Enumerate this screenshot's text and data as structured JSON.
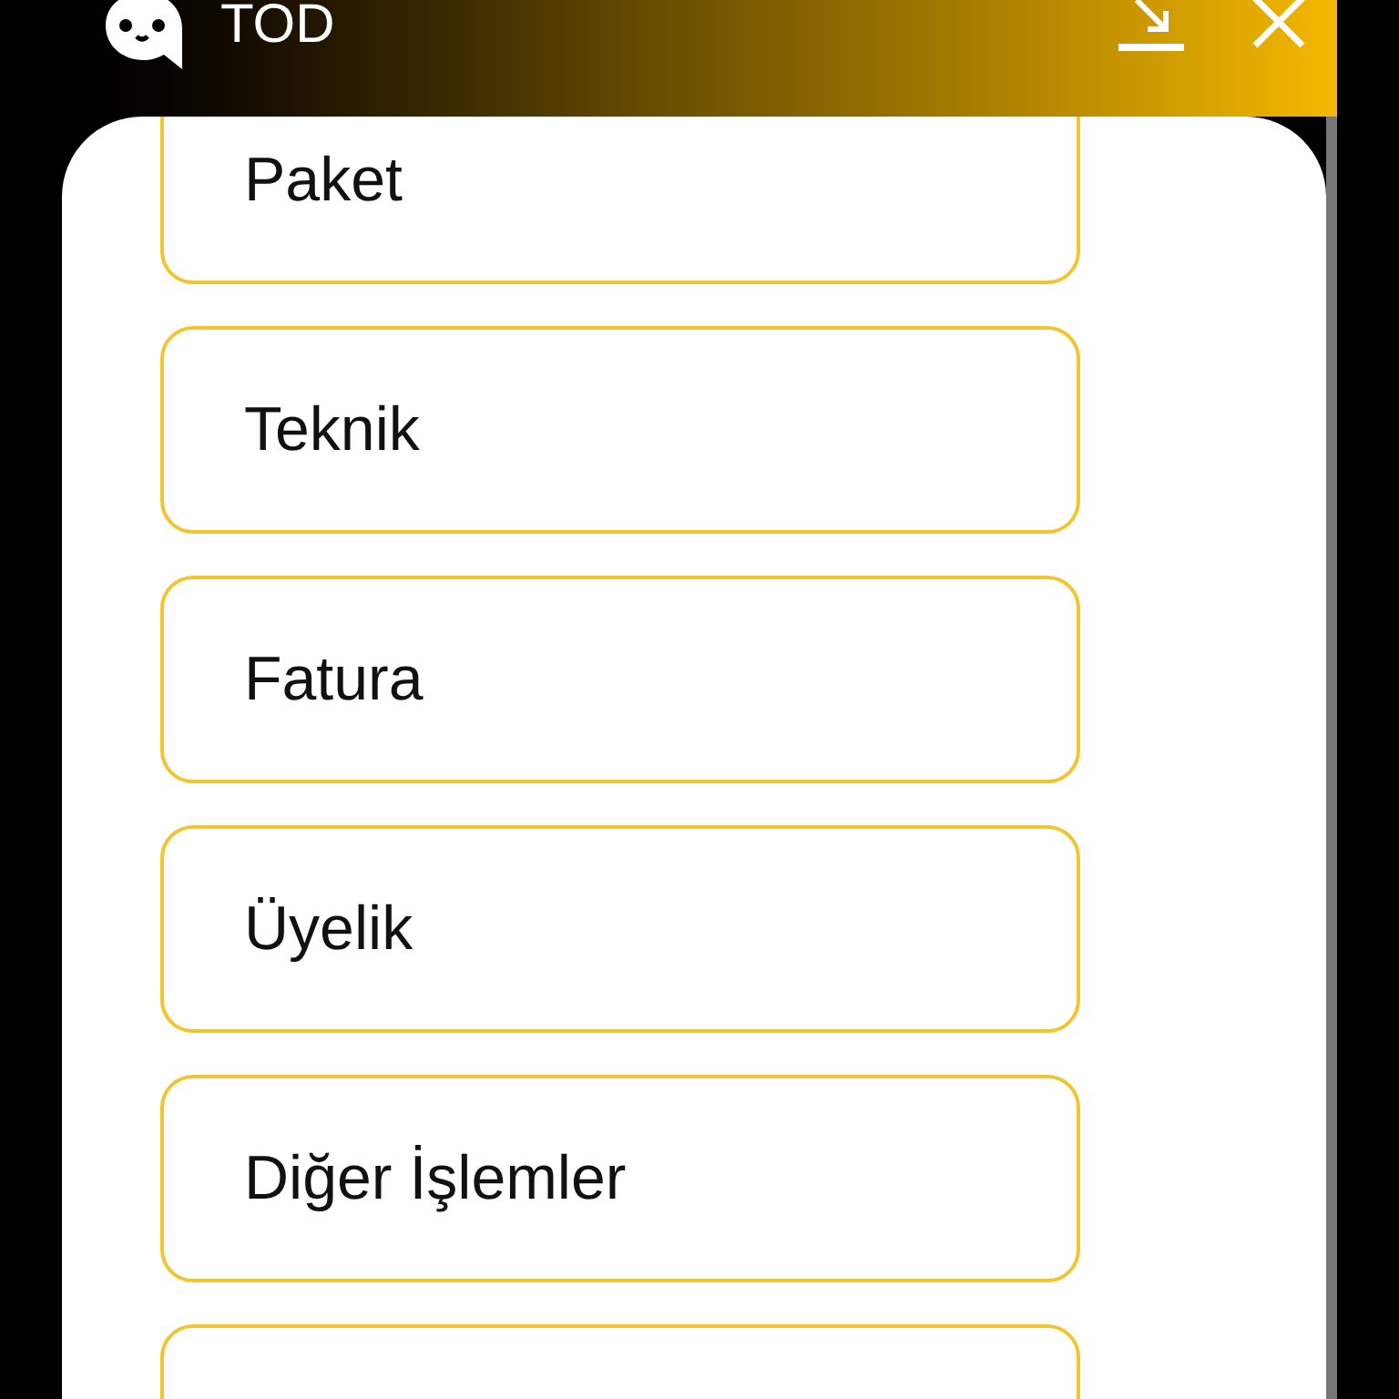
{
  "header": {
    "title": "TOD"
  },
  "options": [
    {
      "label": "Paket"
    },
    {
      "label": "Teknik"
    },
    {
      "label": "Fatura"
    },
    {
      "label": "Üyelik"
    },
    {
      "label": "Diğer İşlemler"
    }
  ]
}
